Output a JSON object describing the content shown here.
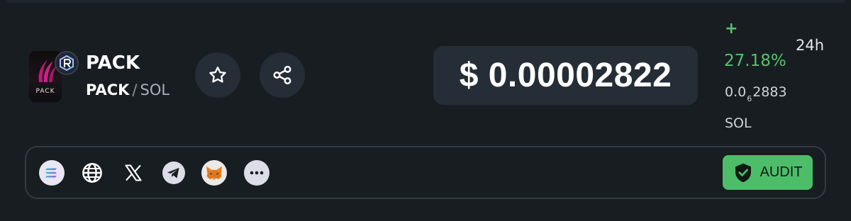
{
  "token": {
    "name": "PACK",
    "logo_text": "PACK",
    "base_symbol": "PACK",
    "separator": "/",
    "quote_symbol": "SOL",
    "dex_badge_icon": "raydium-icon"
  },
  "actions": {
    "favorite_icon": "star-icon",
    "share_icon": "share-icon"
  },
  "price": {
    "usd": "$ 0.00002822"
  },
  "change": {
    "sign": "+",
    "percent": "27.18%",
    "period": "24h",
    "color": "#56c36b"
  },
  "sol_price": {
    "prefix": "0.0",
    "zero_count": "6",
    "digits": "2883",
    "unit": "SOL"
  },
  "links": [
    {
      "icon": "solana-icon"
    },
    {
      "icon": "globe-icon"
    },
    {
      "icon": "x-icon"
    },
    {
      "icon": "telegram-icon"
    },
    {
      "icon": "metamask-icon"
    },
    {
      "icon": "more-icon"
    }
  ],
  "audit": {
    "label": "AUDIT",
    "icon": "shield-check-icon",
    "color": "#4dbd6a"
  },
  "colors": {
    "background": "#181d22",
    "button_bg": "#252d36",
    "border": "#323a45"
  }
}
